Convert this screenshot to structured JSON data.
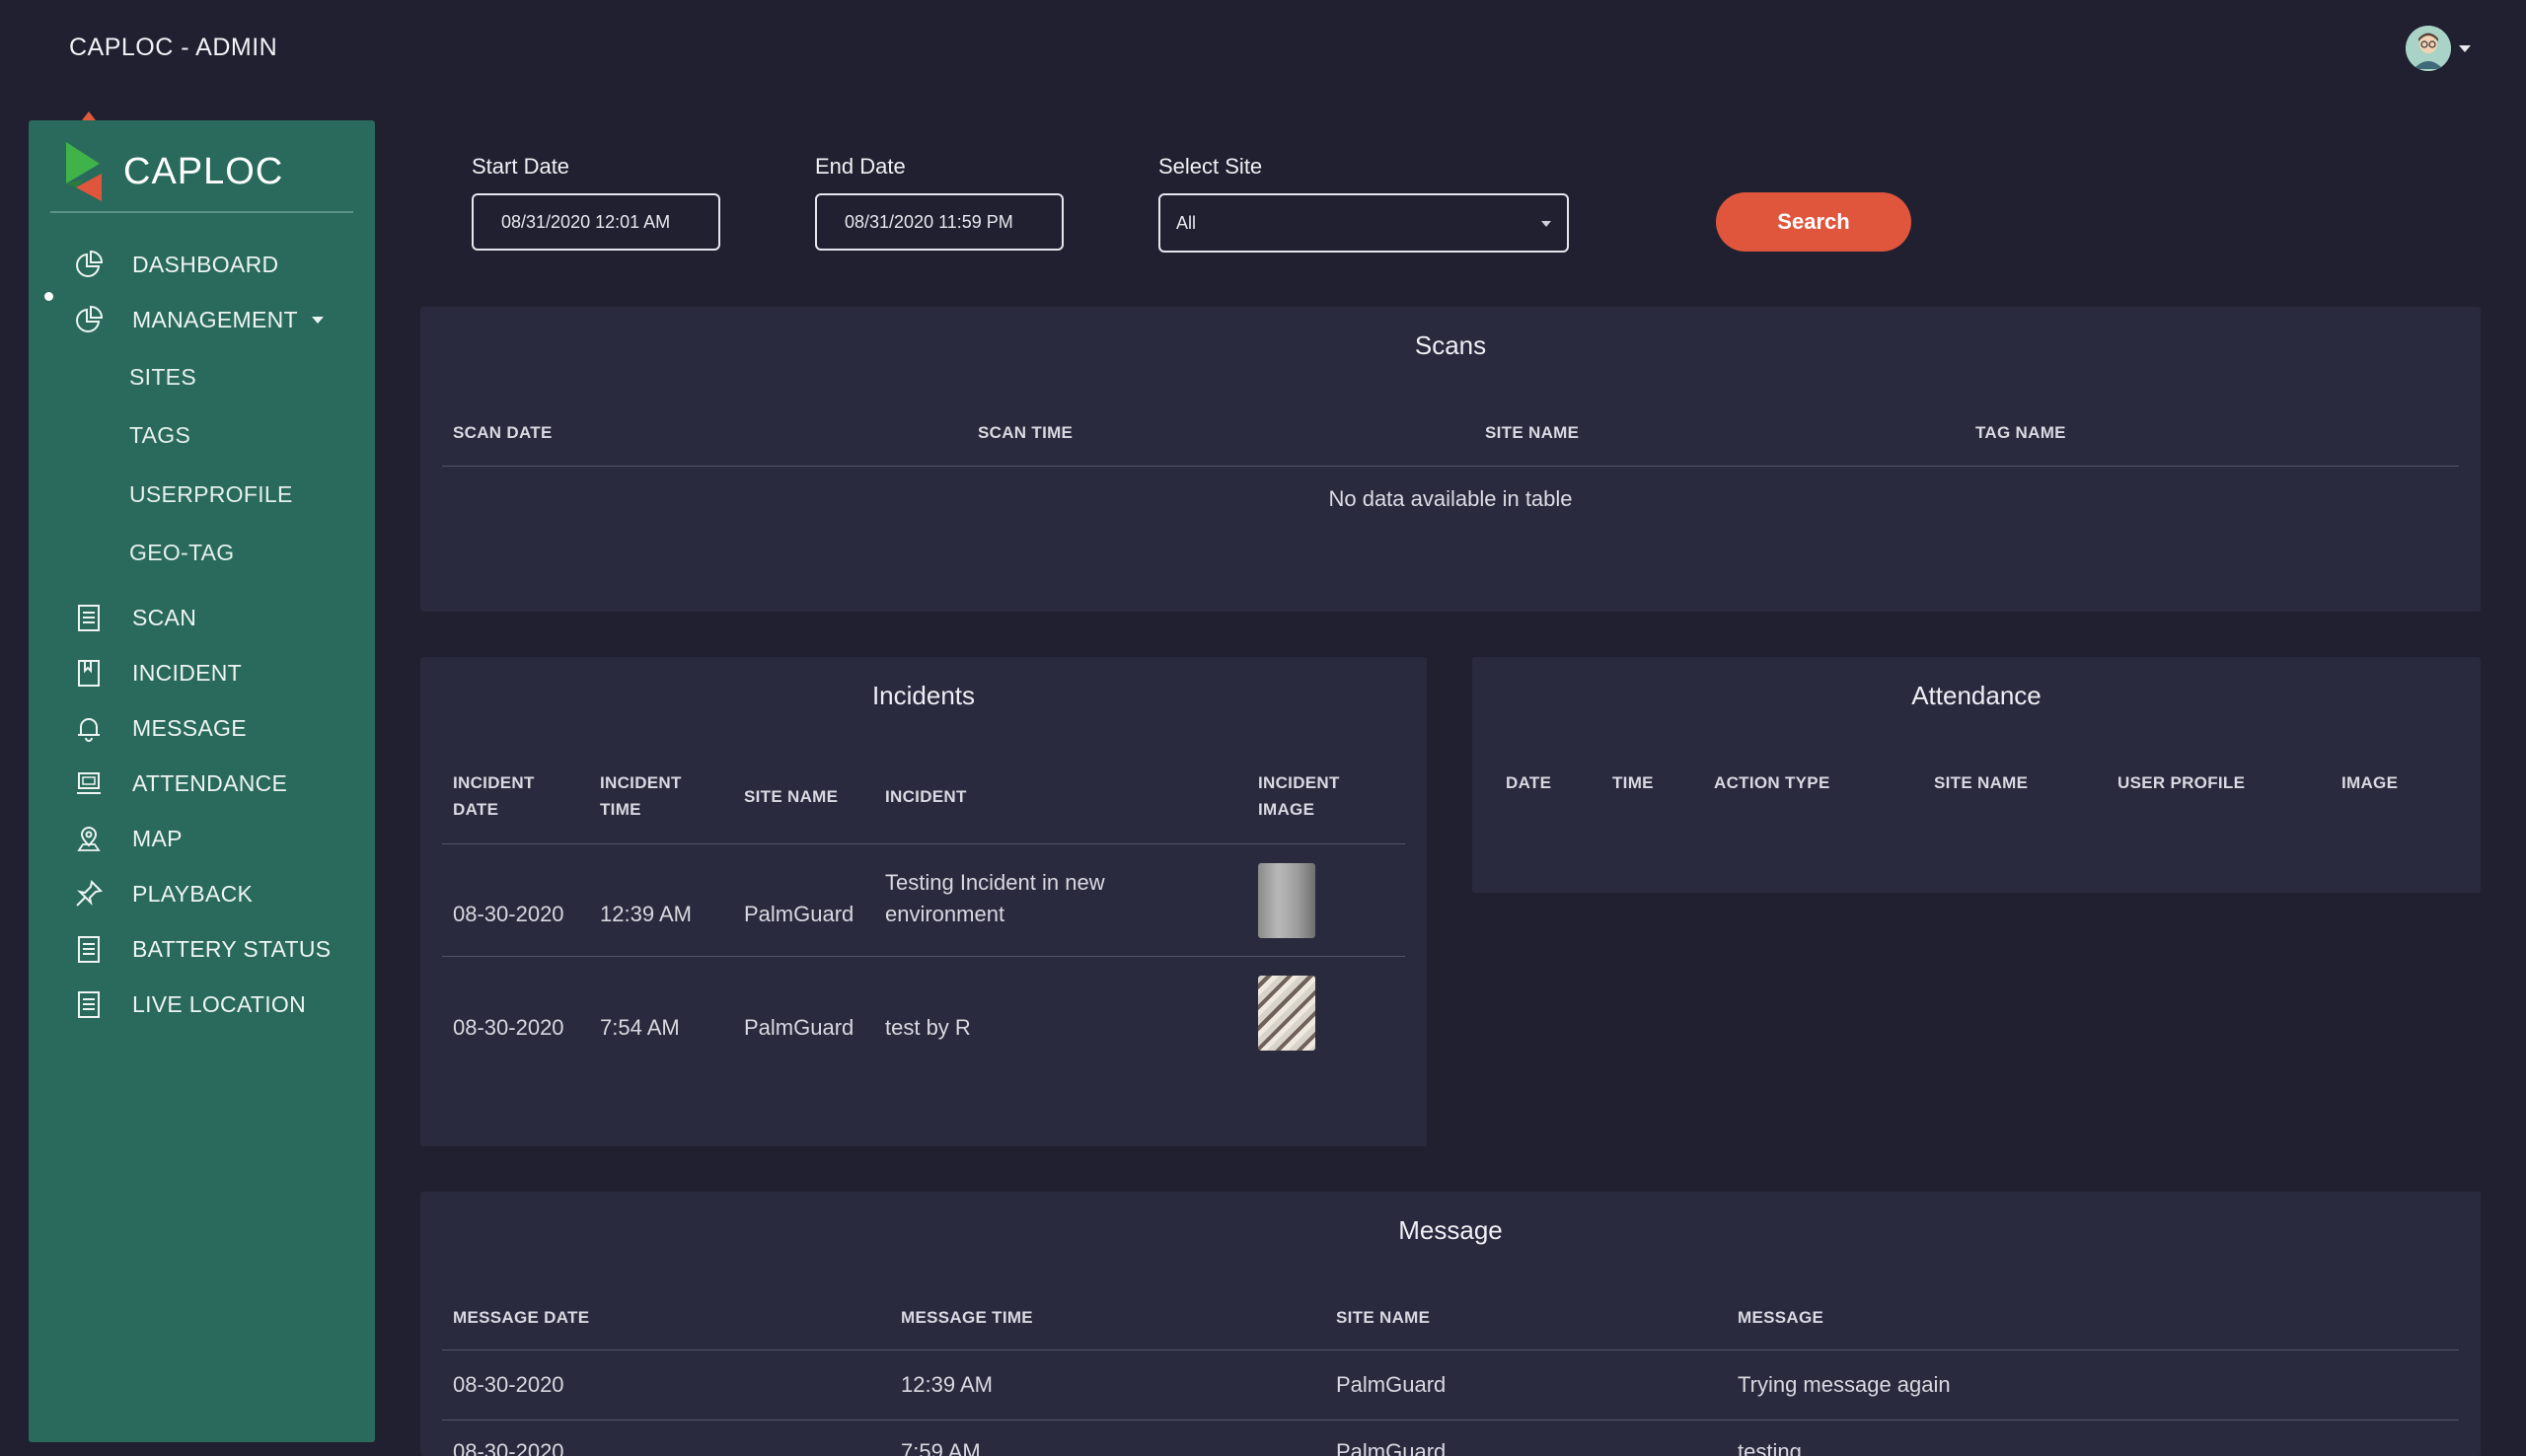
{
  "app_title": "CAPLOC - ADMIN",
  "brand": {
    "name": "CAPLOC"
  },
  "nav": {
    "dashboard": "DASHBOARD",
    "management": "MANAGEMENT",
    "sub": {
      "sites": "SITES",
      "tags": "TAGS",
      "userprofile": "USERPROFILE",
      "geotag": "GEO-TAG"
    },
    "scan": "SCAN",
    "incident": "INCIDENT",
    "message": "MESSAGE",
    "attendance": "ATTENDANCE",
    "map": "MAP",
    "playback": "PLAYBACK",
    "battery_status": "BATTERY STATUS",
    "live_location": "LIVE LOCATION"
  },
  "filters": {
    "start_label": "Start Date",
    "start_value": "08/31/2020 12:01 AM",
    "end_label": "End Date",
    "end_value": "08/31/2020 11:59 PM",
    "site_label": "Select Site",
    "site_value": "All",
    "search_label": "Search"
  },
  "scans": {
    "title": "Scans",
    "headers": [
      "SCAN DATE",
      "SCAN TIME",
      "SITE NAME",
      "TAG NAME"
    ],
    "empty": "No data available in table"
  },
  "incidents": {
    "title": "Incidents",
    "headers": {
      "date": "INCIDENT DATE",
      "time": "INCIDENT TIME",
      "site": "SITE NAME",
      "incident": "INCIDENT",
      "image": "INCIDENT IMAGE"
    },
    "rows": [
      {
        "date": "08-30-2020",
        "time": "12:39 AM",
        "site": "PalmGuard",
        "incident": "Testing Incident in new environment"
      },
      {
        "date": "08-30-2020",
        "time": "7:54 AM",
        "site": "PalmGuard",
        "incident": "test by R"
      }
    ]
  },
  "attendance": {
    "title": "Attendance",
    "headers": [
      "DATE",
      "TIME",
      "ACTION TYPE",
      "SITE NAME",
      "USER PROFILE",
      "IMAGE"
    ]
  },
  "message": {
    "title": "Message",
    "headers": [
      "MESSAGE DATE",
      "MESSAGE TIME",
      "SITE NAME",
      "MESSAGE"
    ],
    "rows": [
      {
        "date": "08-30-2020",
        "time": "12:39 AM",
        "site": "PalmGuard",
        "message": "Trying message again"
      },
      {
        "date": "08-30-2020",
        "time": "7:59 AM",
        "site": "PalmGuard",
        "message": "testing"
      }
    ]
  },
  "colors": {
    "background": "#202030",
    "sidebar": "#296a5c",
    "panel": "#2a2a3e",
    "accent": "#e0563c"
  }
}
